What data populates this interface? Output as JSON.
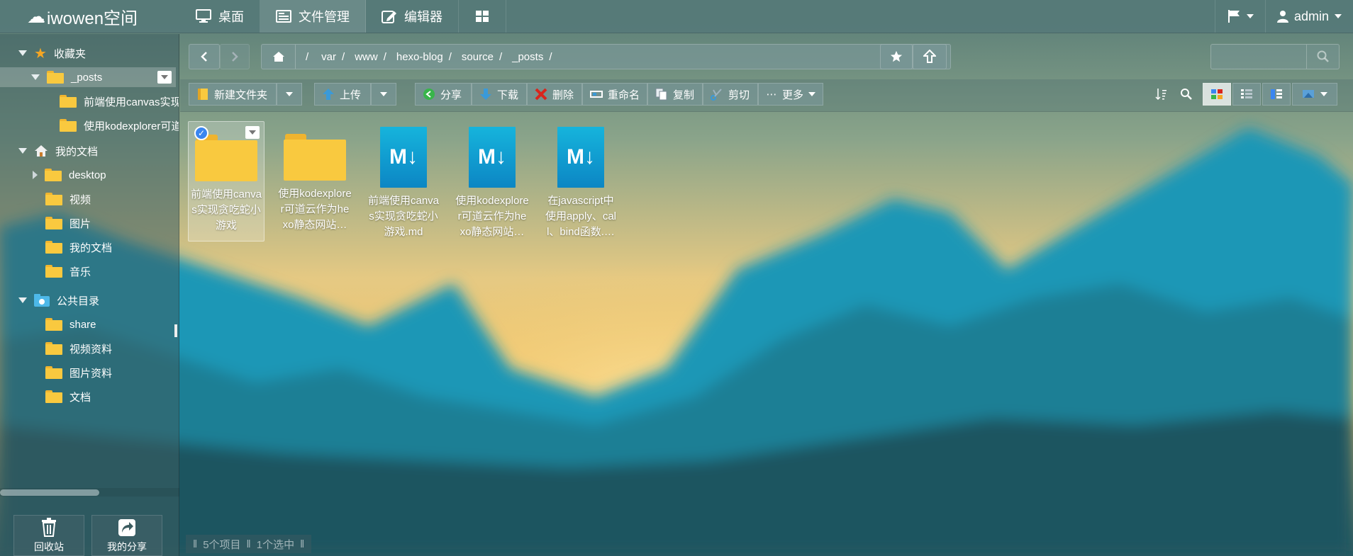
{
  "colors": {
    "accent": "#3a86f0",
    "folder": "#f9c93f",
    "markdown": "#16b4dc"
  },
  "app": {
    "logo_text": "iwowen空间"
  },
  "nav": {
    "tabs": [
      {
        "label": "桌面",
        "icon": "desktop-icon"
      },
      {
        "label": "文件管理",
        "icon": "file-manager-icon"
      },
      {
        "label": "编辑器",
        "icon": "editor-icon"
      },
      {
        "label": "",
        "icon": "apps-grid-icon"
      }
    ],
    "user": "admin"
  },
  "sidebar": {
    "favorites": {
      "label": "收藏夹",
      "items": [
        {
          "label": "_posts"
        },
        {
          "label": "前端使用canvas实现贪吃蛇小游戏"
        },
        {
          "label": "使用kodexplorer可道云作为hexo静态网站"
        }
      ]
    },
    "my_docs": {
      "label": "我的文档",
      "items": [
        {
          "label": "desktop"
        },
        {
          "label": "视频"
        },
        {
          "label": "图片"
        },
        {
          "label": "我的文档"
        },
        {
          "label": "音乐"
        }
      ]
    },
    "public": {
      "label": "公共目录",
      "items": [
        {
          "label": "share"
        },
        {
          "label": "视频资料"
        },
        {
          "label": "图片资料"
        },
        {
          "label": "文档"
        }
      ]
    },
    "bottom": {
      "recycle_label": "回收站",
      "share_label": "我的分享"
    }
  },
  "breadcrumb": [
    "/",
    "var",
    "www",
    "hexo-blog",
    "source",
    "_posts"
  ],
  "toolbar": {
    "new_folder": "新建文件夹",
    "upload": "上传",
    "share": "分享",
    "download": "下载",
    "delete": "删除",
    "rename": "重命名",
    "copy": "复制",
    "cut": "剪切",
    "more": "更多"
  },
  "files": [
    {
      "type": "folder",
      "name": "前端使用canvas实现贪吃蛇小游戏",
      "selected": true
    },
    {
      "type": "folder",
      "name": "使用kodexplorer可道云作为hexo静态网站…",
      "selected": false
    },
    {
      "type": "md",
      "name": "前端使用canvas实现贪吃蛇小游戏.md",
      "selected": false
    },
    {
      "type": "md",
      "name": "使用kodexplorer可道云作为hexo静态网站…",
      "selected": false
    },
    {
      "type": "md",
      "name": "在javascript中使用apply、call、bind函数.…",
      "selected": false
    }
  ],
  "md_badge": "M↓",
  "status": {
    "items": "5个项目",
    "selected": "1个选中"
  }
}
